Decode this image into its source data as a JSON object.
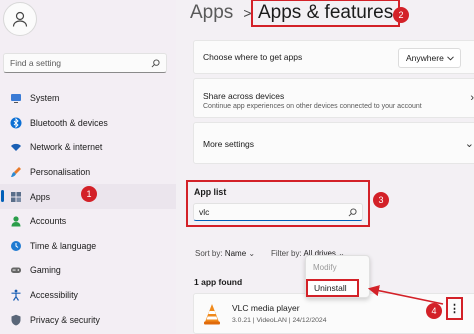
{
  "sidebar": {
    "search_placeholder": "Find a setting",
    "items": [
      {
        "label": "System",
        "icon": "monitor-icon"
      },
      {
        "label": "Bluetooth & devices",
        "icon": "bluetooth-icon"
      },
      {
        "label": "Network & internet",
        "icon": "wifi-icon"
      },
      {
        "label": "Personalisation",
        "icon": "brush-icon"
      },
      {
        "label": "Apps",
        "icon": "apps-icon",
        "active": true
      },
      {
        "label": "Accounts",
        "icon": "person-icon"
      },
      {
        "label": "Time & language",
        "icon": "globe-clock-icon"
      },
      {
        "label": "Gaming",
        "icon": "gamepad-icon"
      },
      {
        "label": "Accessibility",
        "icon": "accessibility-icon"
      },
      {
        "label": "Privacy & security",
        "icon": "shield-icon"
      }
    ]
  },
  "breadcrumb": {
    "parent": "Apps",
    "separator": ">",
    "current": "Apps & features"
  },
  "cards": {
    "where_title": "Choose where to get apps",
    "where_value": "Anywhere",
    "share_title": "Share across devices",
    "share_sub": "Continue app experiences on other devices connected to your account",
    "more_title": "More settings"
  },
  "app_list": {
    "label": "App list",
    "search_value": "vlc",
    "sort_label": "Sort by:",
    "sort_value": "Name",
    "filter_label": "Filter by:",
    "filter_value": "All drives",
    "found": "1 app found"
  },
  "app": {
    "name": "VLC media player",
    "meta": "3.0.21  |  VideoLAN  |  24/12/2024",
    "more": "⋮"
  },
  "context_menu": {
    "modify": "Modify",
    "uninstall": "Uninstall"
  },
  "steps": [
    "1",
    "2",
    "3",
    "4"
  ],
  "colors": {
    "accent": "#005fb8",
    "annotation": "#d32128"
  }
}
